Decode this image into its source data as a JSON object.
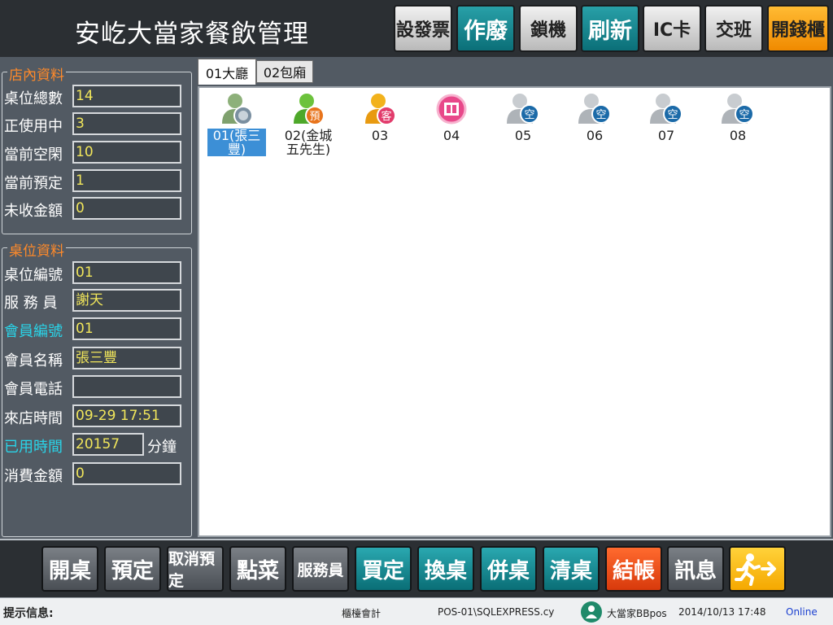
{
  "header": {
    "title": "安屹大當家餐飲管理",
    "buttons": [
      {
        "label": "設發票",
        "style": "gray"
      },
      {
        "label": "作廢",
        "style": "teal"
      },
      {
        "label": "鎖機",
        "style": "gray"
      },
      {
        "label": "刷新",
        "style": "teal"
      },
      {
        "label": "IC卡",
        "style": "gray"
      },
      {
        "label": "交班",
        "style": "gray"
      },
      {
        "label": "開錢櫃",
        "style": "orange"
      }
    ]
  },
  "store_info": {
    "legend": "店內資料",
    "fields": [
      {
        "label": "桌位總數",
        "value": "14"
      },
      {
        "label": "正使用中",
        "value": "3"
      },
      {
        "label": "當前空閑",
        "value": "10"
      },
      {
        "label": "當前預定",
        "value": "1"
      },
      {
        "label": "未收金額",
        "value": "0"
      }
    ]
  },
  "table_info": {
    "legend": "桌位資料",
    "fields": [
      {
        "label": "桌位編號",
        "value": "01"
      },
      {
        "label": "服 務 員",
        "value": "謝天"
      },
      {
        "label": "會員編號",
        "value": "01"
      },
      {
        "label": "會員名稱",
        "value": "張三豐"
      },
      {
        "label": "會員電話",
        "value": ""
      },
      {
        "label": "來店時間",
        "value": "09-29 17:51"
      },
      {
        "label": "已用時間",
        "value": "20157"
      },
      {
        "label": "消費金額",
        "value": "0"
      }
    ],
    "time_unit": "分鐘"
  },
  "tabs": [
    {
      "label": "01大廳",
      "active": true
    },
    {
      "label": "02包廂",
      "active": false
    }
  ],
  "tables": [
    {
      "label": "01(張三豐)",
      "icon": "dining-person-icon",
      "badge": "",
      "selected": true
    },
    {
      "label": "02(金城五先生)",
      "icon": "reserved-person-icon",
      "badge": "預",
      "selected": false
    },
    {
      "label": "03",
      "icon": "guest-person-icon",
      "badge": "客",
      "selected": false
    },
    {
      "label": "04",
      "icon": "closed-table-icon",
      "badge": "",
      "selected": false
    },
    {
      "label": "05",
      "icon": "empty-person-icon",
      "badge": "空",
      "selected": false
    },
    {
      "label": "06",
      "icon": "empty-person-icon",
      "badge": "空",
      "selected": false
    },
    {
      "label": "07",
      "icon": "empty-person-icon",
      "badge": "空",
      "selected": false
    },
    {
      "label": "08",
      "icon": "empty-person-icon",
      "badge": "空",
      "selected": false
    }
  ],
  "bottom_buttons": [
    {
      "label": "開桌",
      "style": "gray"
    },
    {
      "label": "預定",
      "style": "gray"
    },
    {
      "label": "取消預定",
      "style": "gray"
    },
    {
      "label": "點菜",
      "style": "gray"
    },
    {
      "label": "服務員",
      "style": "gray"
    },
    {
      "label": "買定",
      "style": "teal"
    },
    {
      "label": "換桌",
      "style": "teal"
    },
    {
      "label": "併桌",
      "style": "teal"
    },
    {
      "label": "清桌",
      "style": "teal"
    },
    {
      "label": "結帳",
      "style": "red"
    },
    {
      "label": "訊息",
      "style": "gray"
    }
  ],
  "exit_icon": "exit-runner-icon",
  "status": {
    "hint_label": "提示信息:",
    "role": "櫃檯會計",
    "server": "POS-01\\SQLEXPRESS.cy",
    "brand": "大當家BBpos",
    "datetime": "2014/10/13 17:48",
    "connection": "Online"
  },
  "colors": {
    "panel": "#525a63",
    "legend": "#ff8a2a",
    "field_value": "#f1e65b",
    "teal": "#0b6f78",
    "orange": "#f08a00",
    "red": "#d83a0c",
    "selection": "#3c8fd6",
    "online": "#1a3fd0"
  }
}
